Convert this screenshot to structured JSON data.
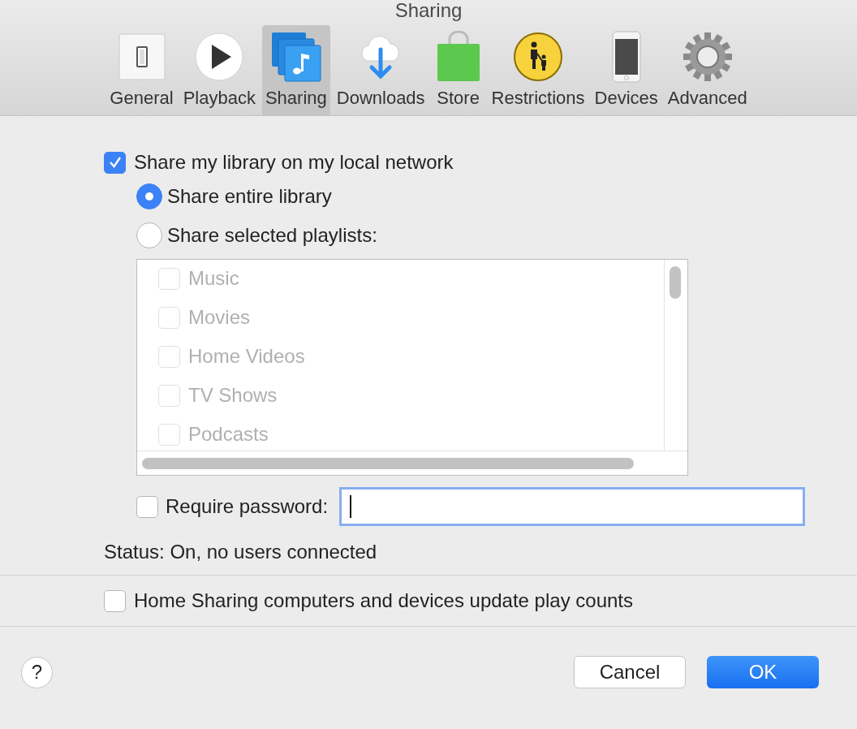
{
  "window": {
    "title": "Sharing"
  },
  "tabs": [
    {
      "label": "General",
      "kind": "general",
      "selected": false
    },
    {
      "label": "Playback",
      "kind": "playback",
      "selected": false
    },
    {
      "label": "Sharing",
      "kind": "sharing",
      "selected": true
    },
    {
      "label": "Downloads",
      "kind": "downloads",
      "selected": false
    },
    {
      "label": "Store",
      "kind": "store",
      "selected": false
    },
    {
      "label": "Restrictions",
      "kind": "restrictions",
      "selected": false
    },
    {
      "label": "Devices",
      "kind": "devices",
      "selected": false
    },
    {
      "label": "Advanced",
      "kind": "advanced",
      "selected": false
    }
  ],
  "share_library": {
    "label": "Share my library on my local network",
    "checked": true
  },
  "share_options": [
    {
      "label": "Share entire library",
      "selected": true
    },
    {
      "label": "Share selected playlists:",
      "selected": false
    }
  ],
  "playlists": {
    "disabled": true,
    "items": [
      {
        "label": "Music",
        "checked": false
      },
      {
        "label": "Movies",
        "checked": false
      },
      {
        "label": "Home Videos",
        "checked": false
      },
      {
        "label": "TV Shows",
        "checked": false
      },
      {
        "label": "Podcasts",
        "checked": false
      }
    ]
  },
  "require_password": {
    "label": "Require password:",
    "checked": false,
    "focused": true
  },
  "status": "Status: On, no users connected",
  "update_play_counts": {
    "label": "Home Sharing computers and devices update play counts",
    "checked": false
  },
  "help": "?",
  "buttons": [
    {
      "label": "Cancel",
      "kind": "secondary"
    },
    {
      "label": "OK",
      "kind": "primary"
    }
  ]
}
